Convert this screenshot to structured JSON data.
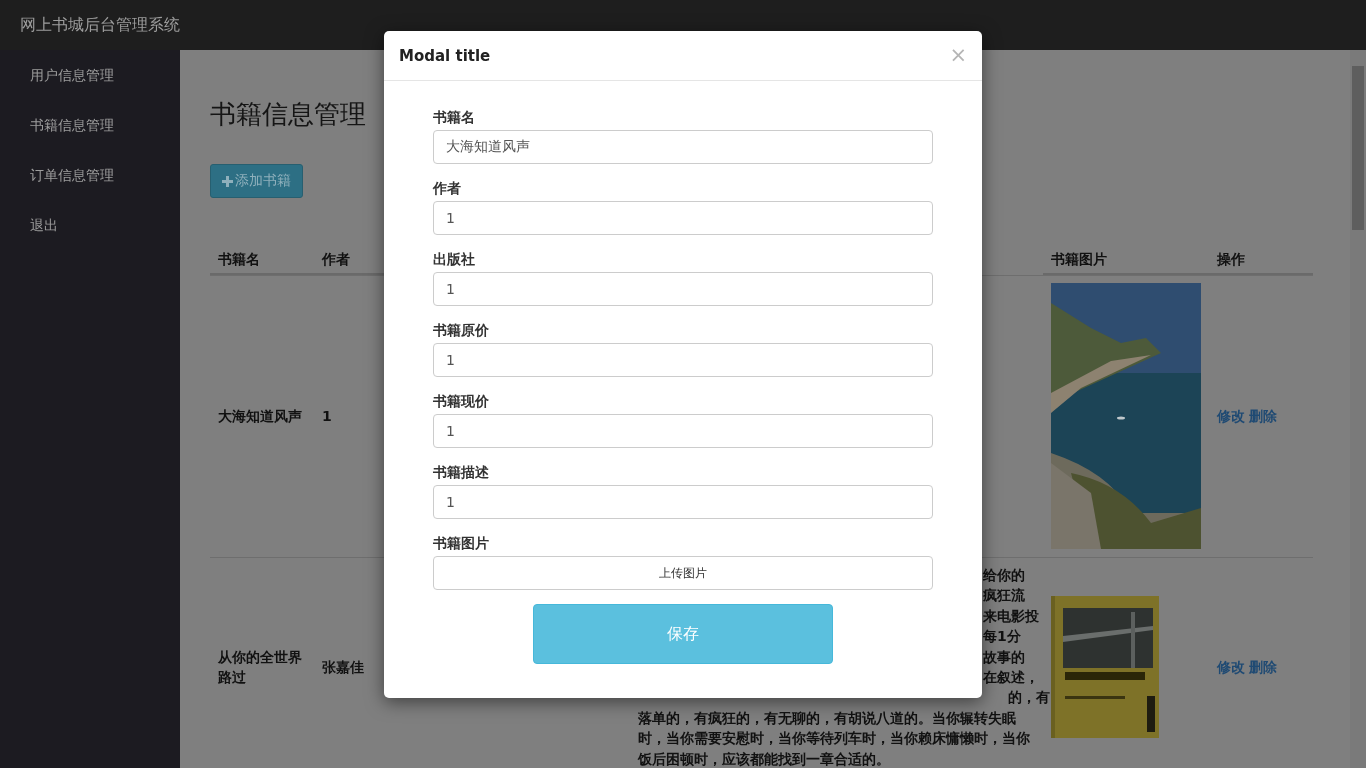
{
  "navbar": {
    "brand": "网上书城后台管理系统"
  },
  "sidebar": {
    "items": [
      {
        "label": "用户信息管理"
      },
      {
        "label": "书籍信息管理"
      },
      {
        "label": "订单信息管理"
      },
      {
        "label": "退出"
      }
    ]
  },
  "page": {
    "title": "书籍信息管理",
    "add_button": "添加书籍"
  },
  "table": {
    "columns": [
      "书籍名",
      "作者",
      "书籍图片",
      "操作"
    ],
    "rows": [
      {
        "name": "大海知道风声",
        "author": "1",
        "description_fragments": [],
        "description_lines": [],
        "image": {
          "kind": "picture"
        },
        "actions": [
          "修改",
          "删除"
        ]
      },
      {
        "name": "从你的全世界路过",
        "author": "张嘉佳",
        "description_fragments": [
          "给你的",
          "疯狂流",
          "来电影投",
          "每1分",
          "故事的",
          "在叙述，",
          "的，有"
        ],
        "description_lines": [
          "落单的，有疯狂的，有无聊的，有胡说八道的。当你辗转失眠",
          "时，当你需要安慰时，当你等待列车时，当你赖床慵懒时，当你",
          "饭后困顿时，应该都能找到一章合适的。"
        ],
        "image": {
          "kind": "picture"
        },
        "actions": [
          "修改",
          "删除"
        ]
      }
    ]
  },
  "modal": {
    "title": "Modal title",
    "close": "×",
    "fields": [
      {
        "kind": "text",
        "label": "书籍名",
        "value": "大海知道风声"
      },
      {
        "kind": "text",
        "label": "作者",
        "value": "1"
      },
      {
        "kind": "text",
        "label": "出版社",
        "value": "1"
      },
      {
        "kind": "text",
        "label": "书籍原价",
        "value": "1"
      },
      {
        "kind": "text",
        "label": "书籍现价",
        "value": "1"
      },
      {
        "kind": "text",
        "label": "书籍描述",
        "value": "1"
      },
      {
        "kind": "upload",
        "label": "书籍图片",
        "value": "上传图片"
      }
    ],
    "save_button": "保存"
  }
}
